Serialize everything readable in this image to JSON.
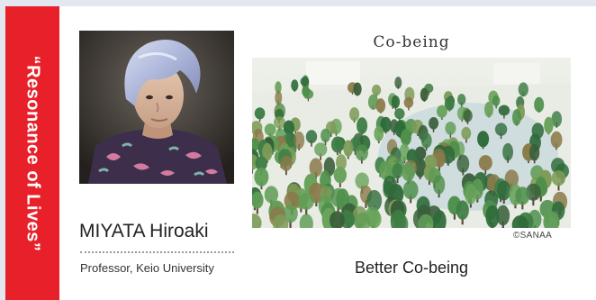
{
  "colors": {
    "page_background": "#e3e8f0",
    "card_background": "#ffffff",
    "accent_red": "#e8202a",
    "text_dark": "#222222",
    "rule_gray": "#9a9a9a"
  },
  "side_tab": {
    "label": "“Resonance of Lives”"
  },
  "person": {
    "portrait_icon": "portrait-photo",
    "name": "MIYATA Hiroaki",
    "affiliation": "Professor, Keio University"
  },
  "project": {
    "title": "Co-being",
    "photo_icon": "forest-model-photo",
    "photo_credit": "©SANAA",
    "subtitle": "Better Co-being"
  }
}
